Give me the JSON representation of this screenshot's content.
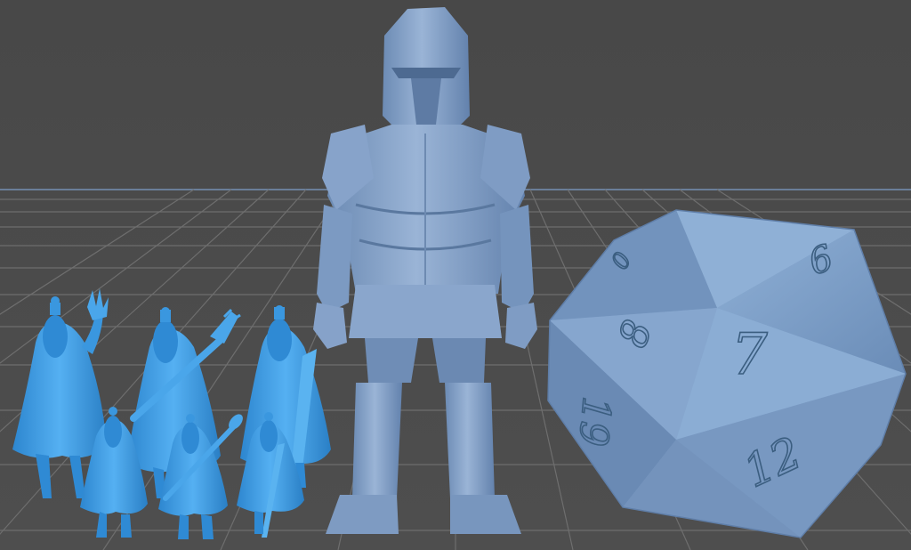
{
  "scene": {
    "background_color": "#4a4a4a",
    "grid_color": "#6e6e6e",
    "horizon_color": "#6a7e98",
    "model_color_primary": "#3f9be2",
    "model_color_secondary": "#7c9cc4",
    "model_color_die": "#7a9dc5"
  },
  "objects": {
    "small_figures": {
      "count": 6,
      "icon": "robed-figure-icon"
    },
    "armored_knight": {
      "icon": "knight-figure-icon"
    },
    "d20_die": {
      "icon": "d20-die-icon",
      "face_numbers": [
        "7",
        "8",
        "19",
        "12",
        "9",
        "0"
      ]
    }
  }
}
